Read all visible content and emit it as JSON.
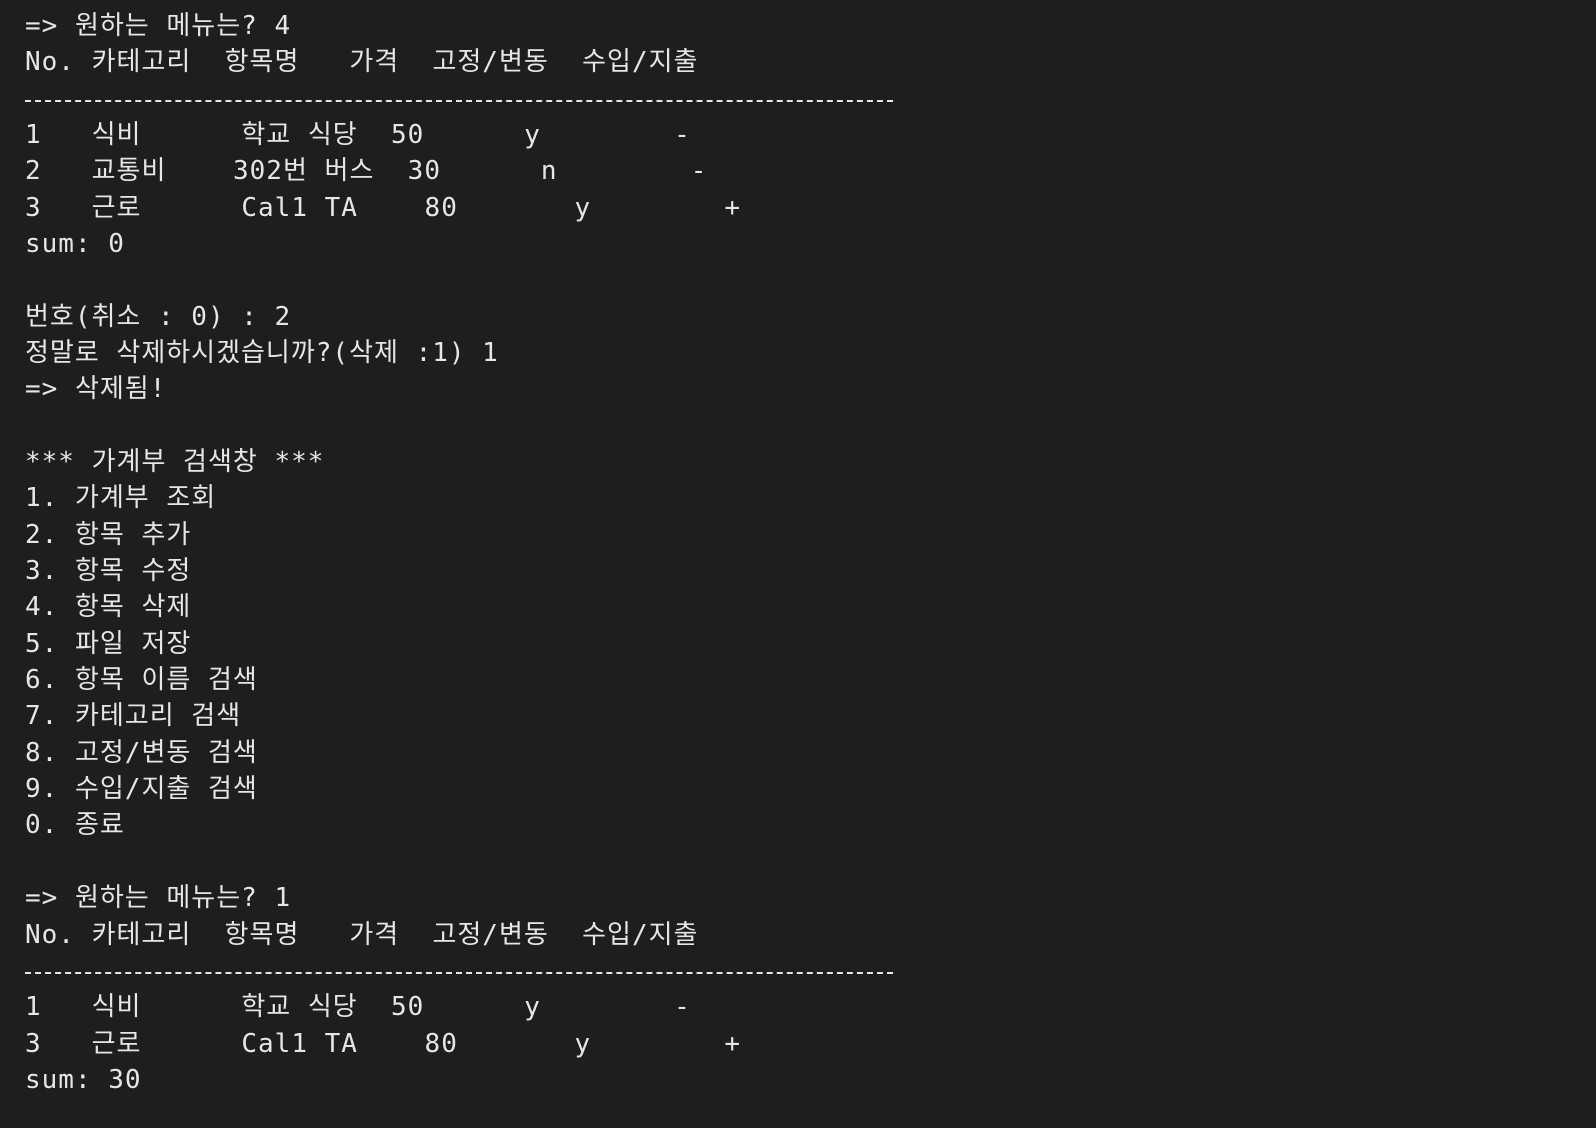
{
  "terminal": {
    "prompt1": "=> 원하는 메뉴는? 4",
    "header1": "No. 카테고리  항목명   가격  고정/변동  수입/지출",
    "list1": {
      "row1": "1   식비      학교 식당  50      y        -",
      "row2": "2   교통비    302번 버스  30      n        -",
      "row3": "3   근로      Cal1 TA    80       y        +",
      "sum": "sum: 0"
    },
    "delete_prompt": "번호(취소 : 0) : 2",
    "confirm_prompt": "정말로 삭제하시겠습니까?(삭제 :1) 1",
    "deleted_msg": "=> 삭제됨!",
    "menu": {
      "title": "*** 가계부 검색창 ***",
      "items": [
        "1. 가계부 조회",
        "2. 항목 추가",
        "3. 항목 수정",
        "4. 항목 삭제",
        "5. 파일 저장",
        "6. 항목 이름 검색",
        "7. 카테고리 검색",
        "8. 고정/변동 검색",
        "9. 수입/지출 검색",
        "0. 종료"
      ]
    },
    "prompt2": "=> 원하는 메뉴는? 1",
    "header2": "No. 카테고리  항목명   가격  고정/변동  수입/지출",
    "list2": {
      "row1": "1   식비      학교 식당  50      y        -",
      "row2": "3   근로      Cal1 TA    80       y        +",
      "sum": "sum: 30"
    }
  }
}
